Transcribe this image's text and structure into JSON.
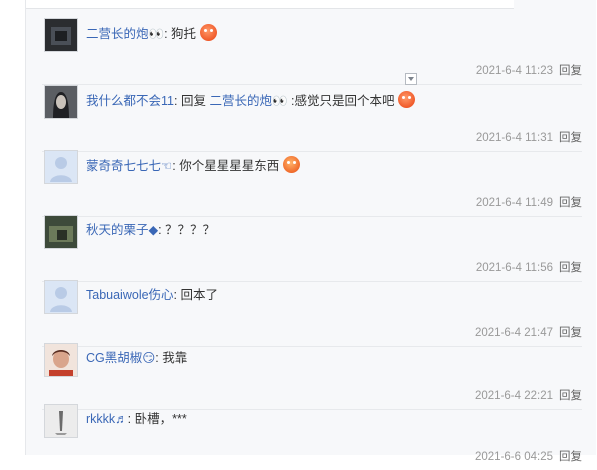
{
  "comments": [
    {
      "user": "二营长的炮👀",
      "sep": ":",
      "text": "狗托",
      "time": "2021-6-4 11:23",
      "reply": "回复"
    },
    {
      "user": "我什么都不会11",
      "sep": ":",
      "reply_word": "回复",
      "ref_user": "二营长的炮👀",
      "text": ":感觉只是回个本吧",
      "time": "2021-6-4 11:31",
      "reply": "回复"
    },
    {
      "user": "蒙奇奇七七七☜",
      "sep": ":",
      "text": "你个星星星星东西",
      "time": "2021-6-4 11:49",
      "reply": "回复"
    },
    {
      "user": "秋天的栗子◆",
      "sep": ":",
      "text": "？？？？",
      "time": "2021-6-4 11:56",
      "reply": "回复"
    },
    {
      "user": "Tabuaiwole伤心",
      "sep": ":",
      "text": "回本了",
      "time": "2021-6-4 21:47",
      "reply": "回复"
    },
    {
      "user": "CG黑胡椒😏",
      "sep": ":",
      "text": "我靠",
      "time": "2021-6-4 22:21",
      "reply": "回复"
    },
    {
      "user": "rkkkk♬",
      "sep": ":",
      "text": "卧槽，***",
      "time": "2021-6-6 04:25",
      "reply": "回复"
    }
  ],
  "colors": {
    "user": "#3a67b6",
    "time": "#999999",
    "panel": "#f7f8fa"
  },
  "icons": [
    "angry-emoji",
    "grin-emoji",
    "expand-chevron-icon"
  ]
}
